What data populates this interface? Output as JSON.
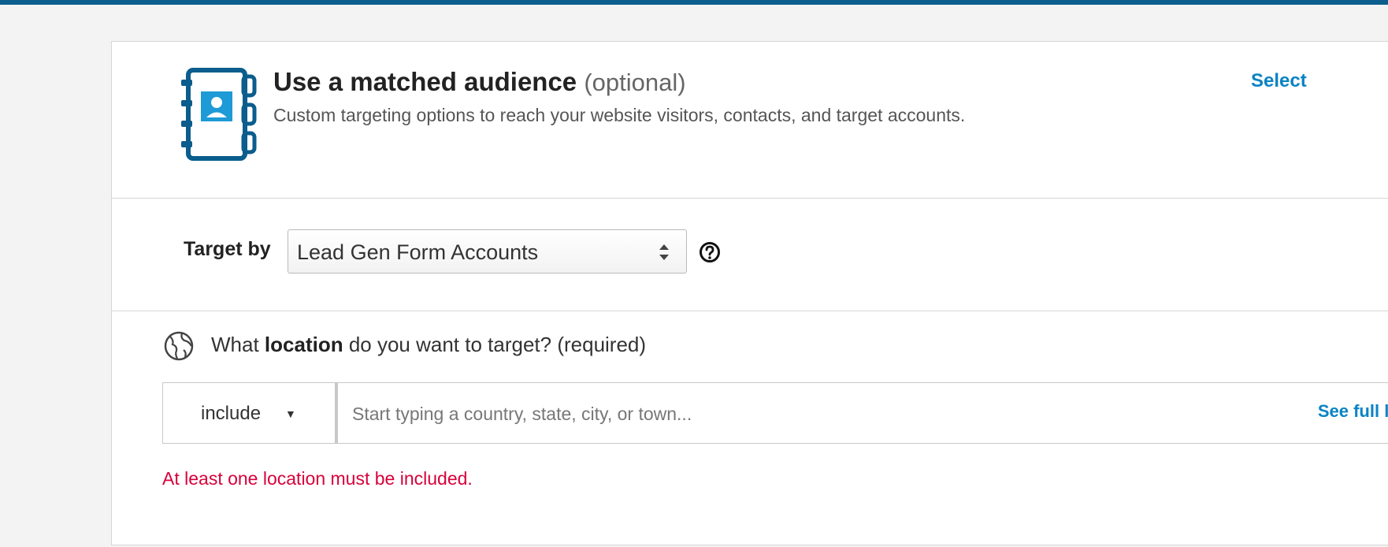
{
  "colors": {
    "accent": "#0a83c4",
    "icon_blue": "#0a5d8c",
    "icon_light": "#1e9ad6",
    "error": "#d8003a",
    "top_bar": "#0a5d8c"
  },
  "matched_audience": {
    "icon": "contact-book-icon",
    "title": "Use a matched audience",
    "title_suffix": "(optional)",
    "subtitle": "Custom targeting options to reach your website visitors, contacts, and target accounts.",
    "select_label": "Select"
  },
  "target_by": {
    "label": "Target by",
    "selected_value": "Lead Gen Form Accounts",
    "help_icon": "question-circle-icon"
  },
  "location": {
    "icon": "globe-icon",
    "question_prefix": "What",
    "question_bold": "location",
    "question_suffix": "do you want to target? (required)",
    "mode_value": "include",
    "mode_arrow": "▼",
    "input_placeholder": "Start typing a country, state, city, or town...",
    "input_value": "",
    "see_full_list_label": "See full list",
    "error_text": "At least one location must be included."
  }
}
